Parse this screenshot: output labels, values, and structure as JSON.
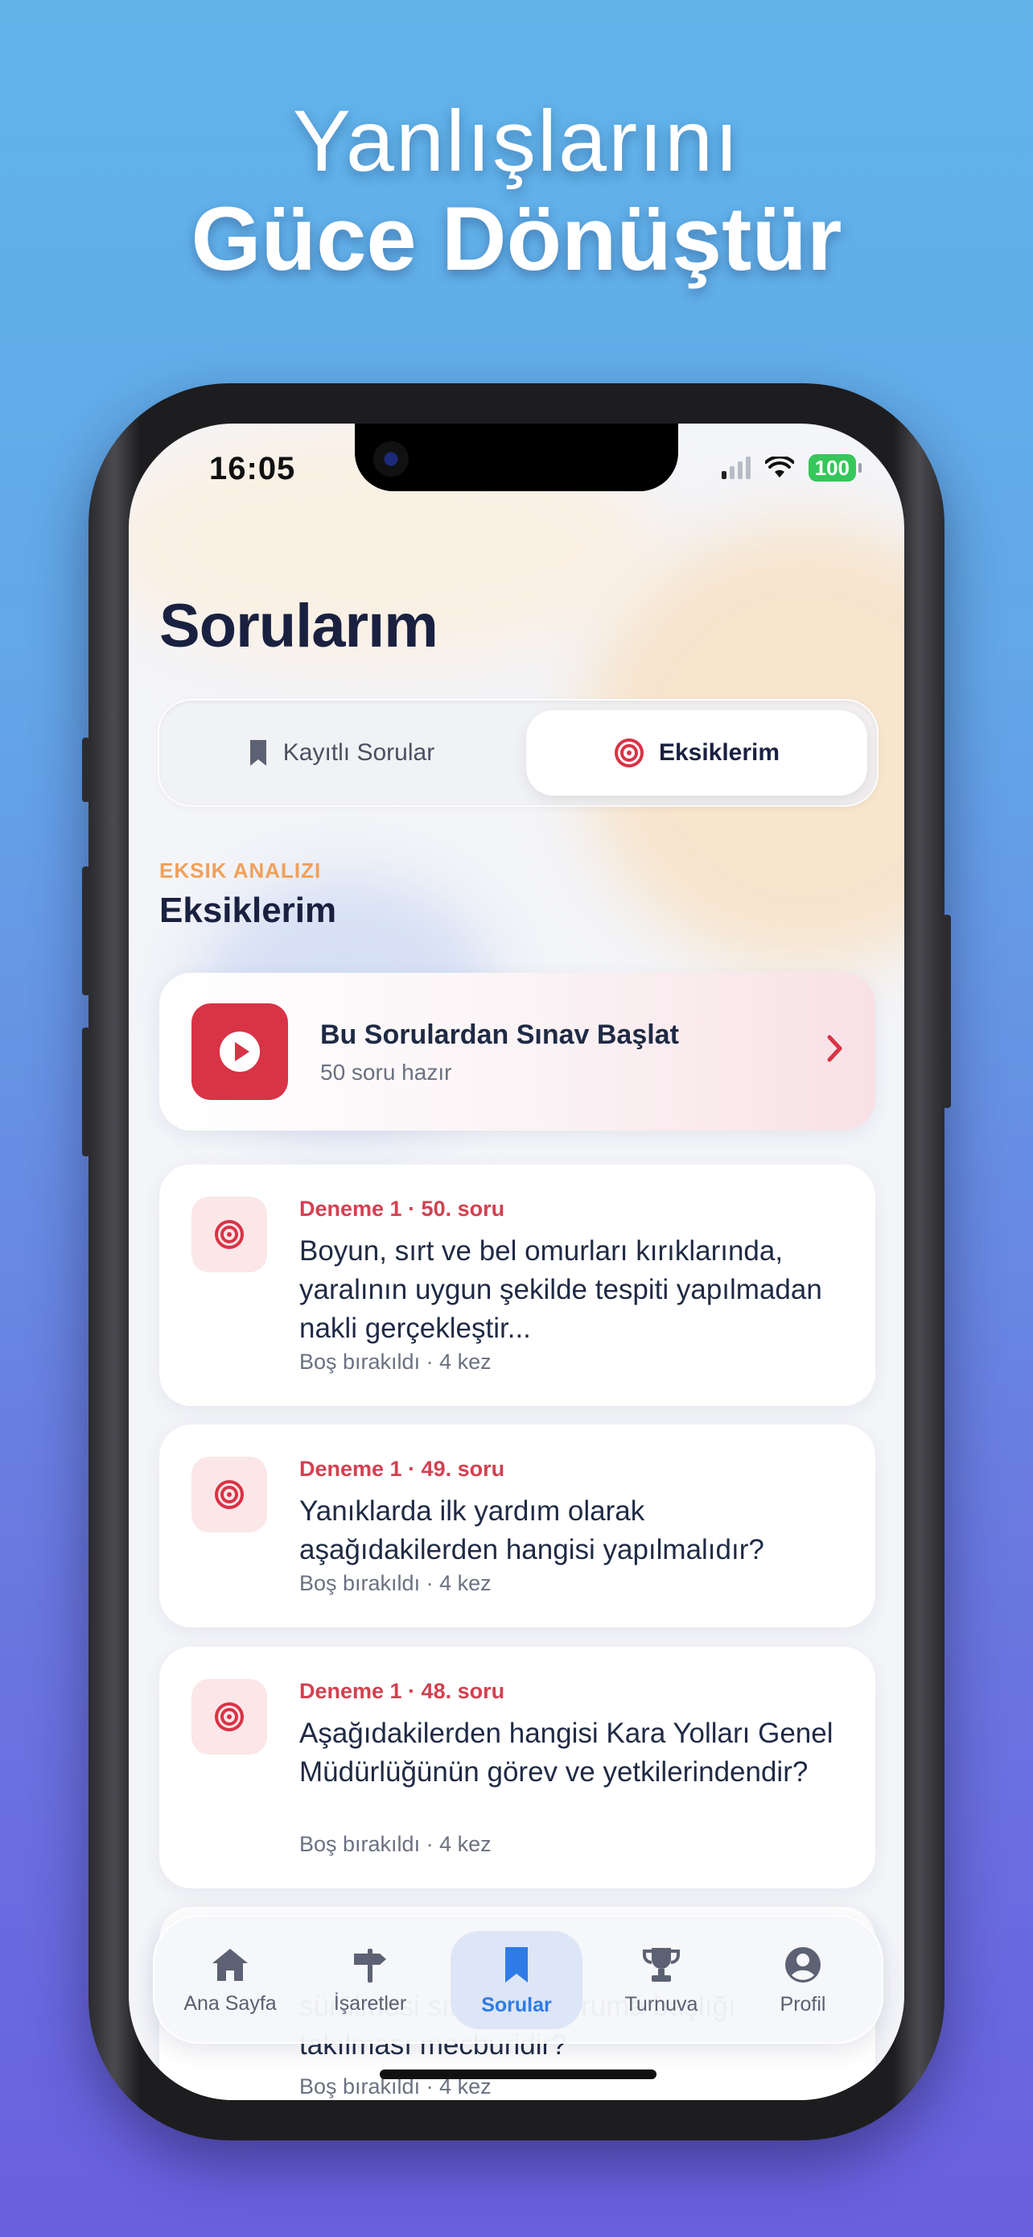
{
  "promo": {
    "line1": "Yanlışlarını",
    "line2": "Güce Dönüştür"
  },
  "status_bar": {
    "time": "16:05",
    "battery": "100"
  },
  "page": {
    "title": "Sorularım"
  },
  "segments": {
    "saved_label": "Kayıtlı Sorular",
    "missing_label": "Eksiklerim",
    "selected": "Eksiklerim"
  },
  "section": {
    "kicker": "EKSIK ANALIZI",
    "title": "Eksiklerim"
  },
  "start_exam": {
    "title": "Bu Sorulardan Sınav Başlat",
    "subtitle": "50 soru hazır"
  },
  "questions": [
    {
      "meta": "Deneme 1 · 50. soru",
      "text": "Boyun, sırt ve bel omurları kırıklarında, yaralının uygun şekilde tespiti yapılmadan nakli gerçekleştir...",
      "sub": "Boş bırakıldı · 4 kez"
    },
    {
      "meta": "Deneme 1 · 49. soru",
      "text": "Yanıklarda ilk yardım olarak aşağıdakilerden hangisi yapılmalıdır?",
      "sub": "Boş bırakıldı · 4 kez"
    },
    {
      "meta": "Deneme 1 · 48. soru",
      "text": "Aşağıdakilerden hangisi Kara Yolları Genel Müdürlüğünün görev ve yetkilerindendir?",
      "sub": "Boş bırakıldı · 4 kez"
    },
    {
      "meta": "",
      "text": "sürülmesi sırasında koruma başlığı takılması mecburidir?",
      "sub": "Boş bırakıldı · 4 kez"
    }
  ],
  "tabbar": {
    "items": [
      {
        "label": "Ana Sayfa",
        "icon": "home-icon"
      },
      {
        "label": "İşaretler",
        "icon": "signpost-icon"
      },
      {
        "label": "Sorular",
        "icon": "bookmark-icon"
      },
      {
        "label": "Turnuva",
        "icon": "trophy-icon"
      },
      {
        "label": "Profil",
        "icon": "profile-icon"
      }
    ],
    "active": "Sorular"
  },
  "colors": {
    "accent_red": "#d93346",
    "accent_blue": "#2f7be5",
    "kicker_orange": "#f0a05a",
    "battery_green": "#35c759"
  }
}
